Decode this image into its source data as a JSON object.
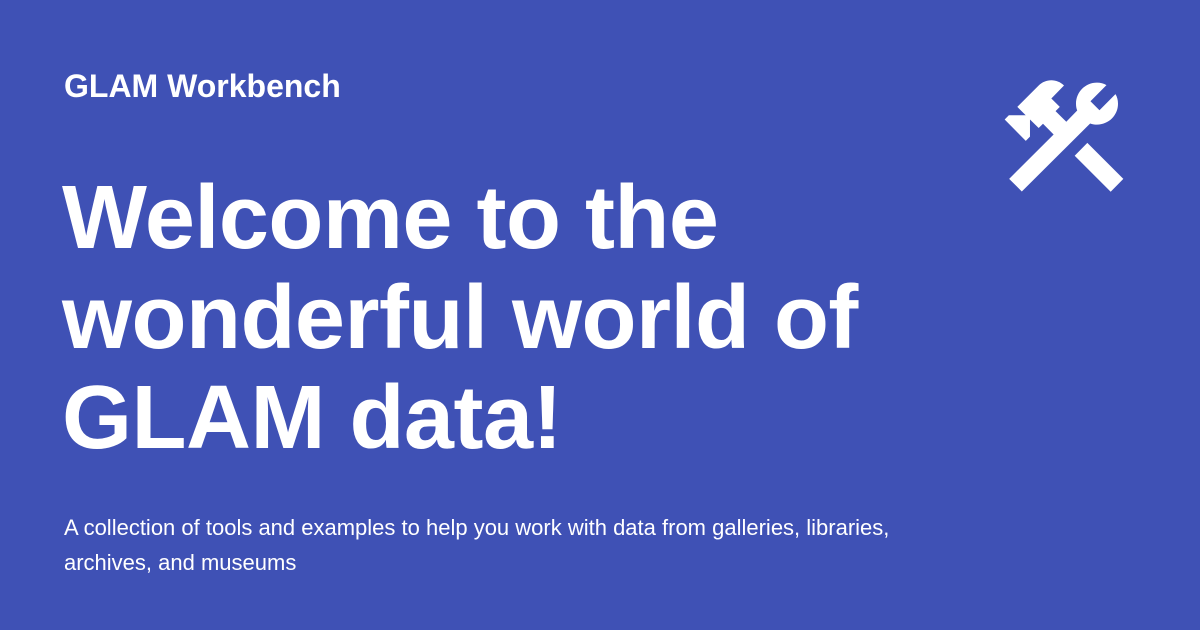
{
  "site_name": "GLAM Workbench",
  "title": "Welcome to the wonderful world of GLAM data!",
  "description": "A collection of tools and examples to help you work with data from galleries, libraries, archives, and museums",
  "logo_icon": "hammer-wrench-icon",
  "colors": {
    "background": "#3f51b5",
    "text": "#ffffff"
  }
}
